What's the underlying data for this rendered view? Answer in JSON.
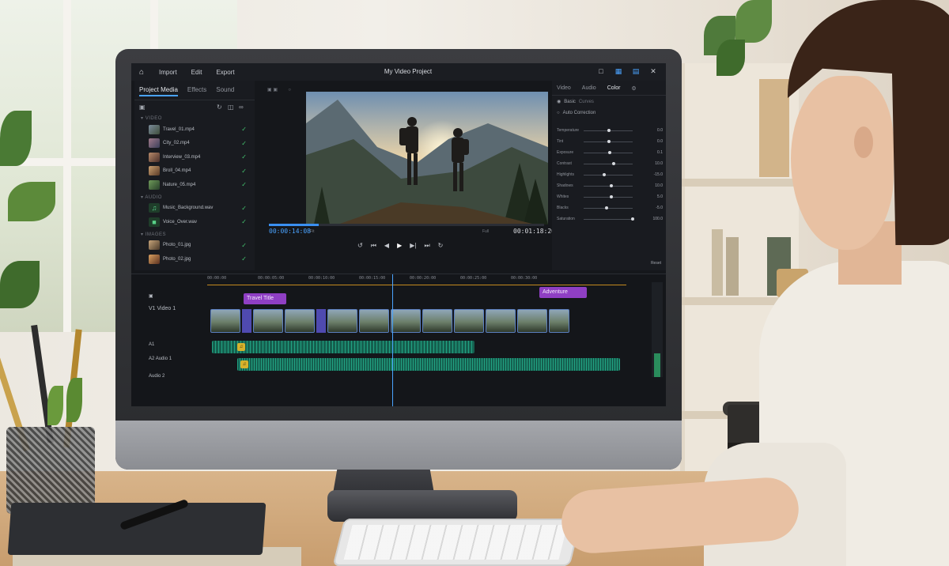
{
  "app": {
    "project_title": "My Video Project",
    "menu": [
      "Import",
      "Edit",
      "Export"
    ]
  },
  "media_panel": {
    "tabs": [
      "Project Media",
      "Effects",
      "Sound"
    ],
    "groups": {
      "video": "VIDEO",
      "audio": "AUDIO",
      "images": "IMAGES"
    },
    "video_files": [
      "Travel_01.mp4",
      "City_02.mp4",
      "Interview_03.mp4",
      "Broll_04.mp4",
      "Nature_05.mp4"
    ],
    "audio_files": [
      "Music_Background.wav",
      "Voice_Over.wav"
    ],
    "image_files": [
      "Photo_01.jpg",
      "Photo_02.jpg"
    ]
  },
  "preview": {
    "current_time": "00:00:14:08",
    "total_time": "00:01:18:20",
    "fit_left": "Fit",
    "fit_right": "Full",
    "progress": 0.18
  },
  "inspector": {
    "tabs": [
      "Video",
      "Audio",
      "Color"
    ],
    "active_tab": "Color",
    "mode_label": "Basic",
    "mode_sub": "Curves",
    "auto_label": "Auto Correction",
    "adjustments": [
      {
        "name": "Temperature",
        "value": "0.0",
        "level": 0.5
      },
      {
        "name": "Tint",
        "value": "0.0",
        "level": 0.5
      },
      {
        "name": "Exposure",
        "value": "0.1",
        "level": 0.52
      },
      {
        "name": "Contrast",
        "value": "10.0",
        "level": 0.6
      },
      {
        "name": "Highlights",
        "value": "-15.0",
        "level": 0.4
      },
      {
        "name": "Shadows",
        "value": "10.0",
        "level": 0.55
      },
      {
        "name": "Whites",
        "value": "5.0",
        "level": 0.55
      },
      {
        "name": "Blacks",
        "value": "-5.0",
        "level": 0.45
      },
      {
        "name": "Saturation",
        "value": "100.0",
        "level": 1.0
      }
    ],
    "reset_label": "Reset"
  },
  "timeline": {
    "ruler_ticks": [
      "00:00:00",
      "00:00:05:00",
      "00:00:10:00",
      "00:00:15:00",
      "00:00:20:00",
      "00:00:25:00",
      "00:00:30:00"
    ],
    "tracks": {
      "v1": "V1",
      "v1_name": "Video 1",
      "a1": "A1",
      "a2": "A2",
      "a1_name": "Audio 1",
      "a2_name": "Audio 2"
    },
    "titles": [
      "Travel Title",
      "Adventure"
    ]
  }
}
